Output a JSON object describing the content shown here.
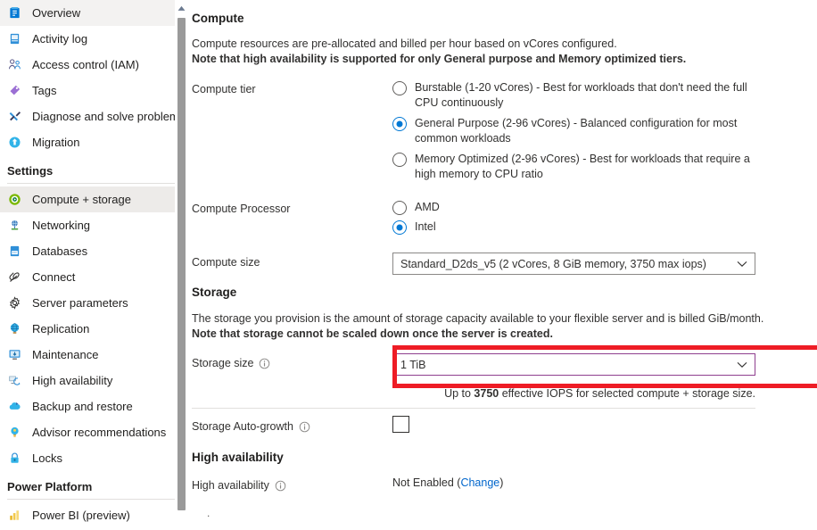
{
  "sidebar": {
    "items": [
      {
        "label": "Overview",
        "icon": "overview-icon",
        "selected": false
      },
      {
        "label": "Activity log",
        "icon": "activity-log-icon",
        "selected": false
      },
      {
        "label": "Access control (IAM)",
        "icon": "access-control-icon",
        "selected": false
      },
      {
        "label": "Tags",
        "icon": "tags-icon",
        "selected": false
      },
      {
        "label": "Diagnose and solve problems",
        "icon": "diagnose-icon",
        "selected": false
      },
      {
        "label": "Migration",
        "icon": "migration-icon",
        "selected": false
      }
    ],
    "settings_group": "Settings",
    "settings_items": [
      {
        "label": "Compute + storage",
        "icon": "compute-storage-icon",
        "selected": true
      },
      {
        "label": "Networking",
        "icon": "networking-icon",
        "selected": false
      },
      {
        "label": "Databases",
        "icon": "databases-icon",
        "selected": false
      },
      {
        "label": "Connect",
        "icon": "connect-icon",
        "selected": false
      },
      {
        "label": "Server parameters",
        "icon": "server-parameters-icon",
        "selected": false
      },
      {
        "label": "Replication",
        "icon": "replication-icon",
        "selected": false
      },
      {
        "label": "Maintenance",
        "icon": "maintenance-icon",
        "selected": false
      },
      {
        "label": "High availability",
        "icon": "high-availability-icon",
        "selected": false
      },
      {
        "label": "Backup and restore",
        "icon": "backup-restore-icon",
        "selected": false
      },
      {
        "label": "Advisor recommendations",
        "icon": "advisor-icon",
        "selected": false
      },
      {
        "label": "Locks",
        "icon": "locks-icon",
        "selected": false
      }
    ],
    "power_platform_group": "Power Platform",
    "power_platform_items": [
      {
        "label": "Power BI (preview)",
        "icon": "power-bi-icon",
        "selected": false
      }
    ]
  },
  "main": {
    "compute": {
      "heading": "Compute",
      "desc_line1": "Compute resources are pre-allocated and billed per hour based on vCores configured.",
      "desc_line2_bold": "Note that high availability is supported for only General purpose and Memory optimized tiers.",
      "tier_label": "Compute tier",
      "tier_options": [
        {
          "label": "Burstable (1-20 vCores) - Best for workloads that don't need the full CPU continuously",
          "selected": false
        },
        {
          "label": "General Purpose (2-96 vCores) - Balanced configuration for most common workloads",
          "selected": true
        },
        {
          "label": "Memory Optimized (2-96 vCores) - Best for workloads that require a high memory to CPU ratio",
          "selected": false
        }
      ],
      "processor_label": "Compute Processor",
      "processor_options": [
        {
          "label": "AMD",
          "selected": false
        },
        {
          "label": "Intel",
          "selected": true
        }
      ],
      "size_label": "Compute size",
      "size_value": "Standard_D2ds_v5 (2 vCores, 8 GiB memory, 3750 max iops)"
    },
    "storage": {
      "heading": "Storage",
      "desc_line1": "The storage you provision is the amount of storage capacity available to your flexible server and is billed GiB/month.",
      "desc_line2_bold": "Note that storage cannot be scaled down once the server is created.",
      "size_label": "Storage size",
      "size_value": "1 TiB",
      "iops_prefix": "Up to ",
      "iops_value": "3750",
      "iops_suffix": " effective IOPS for selected compute + storage size.",
      "autogrowth_label": "Storage Auto-growth",
      "autogrowth_checked": false
    },
    "high_availability": {
      "heading": "High availability",
      "field_label": "High availability",
      "status": "Not Enabled",
      "change_link": "Change"
    }
  },
  "colors": {
    "accent": "#0078d4",
    "highlight_red": "#ee1c25",
    "focus_purple": "#8f3f8f",
    "link_blue": "#0066cc",
    "selected_bg": "#edebe9"
  }
}
